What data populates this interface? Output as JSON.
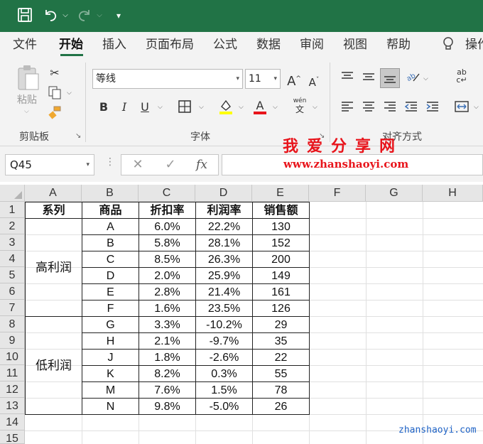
{
  "menu": {
    "tabs": [
      "文件",
      "开始",
      "插入",
      "页面布局",
      "公式",
      "数据",
      "审阅",
      "视图",
      "帮助"
    ],
    "active": "开始",
    "tell_me": "操作"
  },
  "ribbon": {
    "clipboard": {
      "paste_label": "粘贴",
      "group_label": "剪贴板"
    },
    "font": {
      "font_name": "等线",
      "font_size": "11",
      "group_label": "字体",
      "phonetic_label": "wén"
    },
    "alignment": {
      "group_label": "对齐方式"
    }
  },
  "formula_bar": {
    "name_box": "Q45",
    "fx_label": "fx",
    "formula": ""
  },
  "watermark": {
    "title": "我爱分享网",
    "url": "www.zhanshaoyi.com",
    "bottom": "zhanshaoyi.com"
  },
  "sheet": {
    "columns": [
      "A",
      "B",
      "C",
      "D",
      "E",
      "F",
      "G",
      "H"
    ],
    "rows": [
      "1",
      "2",
      "3",
      "4",
      "5",
      "6",
      "7",
      "8",
      "9",
      "10",
      "11",
      "12",
      "13",
      "14",
      "15"
    ],
    "headers": [
      "系列",
      "商品",
      "折扣率",
      "利润率",
      "销售额"
    ],
    "groups": [
      {
        "name": "高利润",
        "items": [
          {
            "product": "A",
            "discount": "6.0%",
            "profit": "22.2%",
            "sales": "130"
          },
          {
            "product": "B",
            "discount": "5.8%",
            "profit": "28.1%",
            "sales": "152"
          },
          {
            "product": "C",
            "discount": "8.5%",
            "profit": "26.3%",
            "sales": "200"
          },
          {
            "product": "D",
            "discount": "2.0%",
            "profit": "25.9%",
            "sales": "149"
          },
          {
            "product": "E",
            "discount": "2.8%",
            "profit": "21.4%",
            "sales": "161"
          },
          {
            "product": "F",
            "discount": "1.6%",
            "profit": "23.5%",
            "sales": "126"
          }
        ]
      },
      {
        "name": "低利润",
        "items": [
          {
            "product": "G",
            "discount": "3.3%",
            "profit": "-10.2%",
            "sales": "29"
          },
          {
            "product": "H",
            "discount": "2.1%",
            "profit": "-9.7%",
            "sales": "35"
          },
          {
            "product": "J",
            "discount": "1.8%",
            "profit": "-2.6%",
            "sales": "22"
          },
          {
            "product": "K",
            "discount": "8.2%",
            "profit": "0.3%",
            "sales": "55"
          },
          {
            "product": "M",
            "discount": "7.6%",
            "profit": "1.5%",
            "sales": "78"
          },
          {
            "product": "N",
            "discount": "9.8%",
            "profit": "-5.0%",
            "sales": "26"
          }
        ]
      }
    ]
  },
  "colors": {
    "title_bar": "#217346",
    "watermark_red": "#e8141b",
    "watermark_blue": "#1f63c6",
    "font_color_red": "#e8141b",
    "highlight_yellow": "#ffff00"
  }
}
